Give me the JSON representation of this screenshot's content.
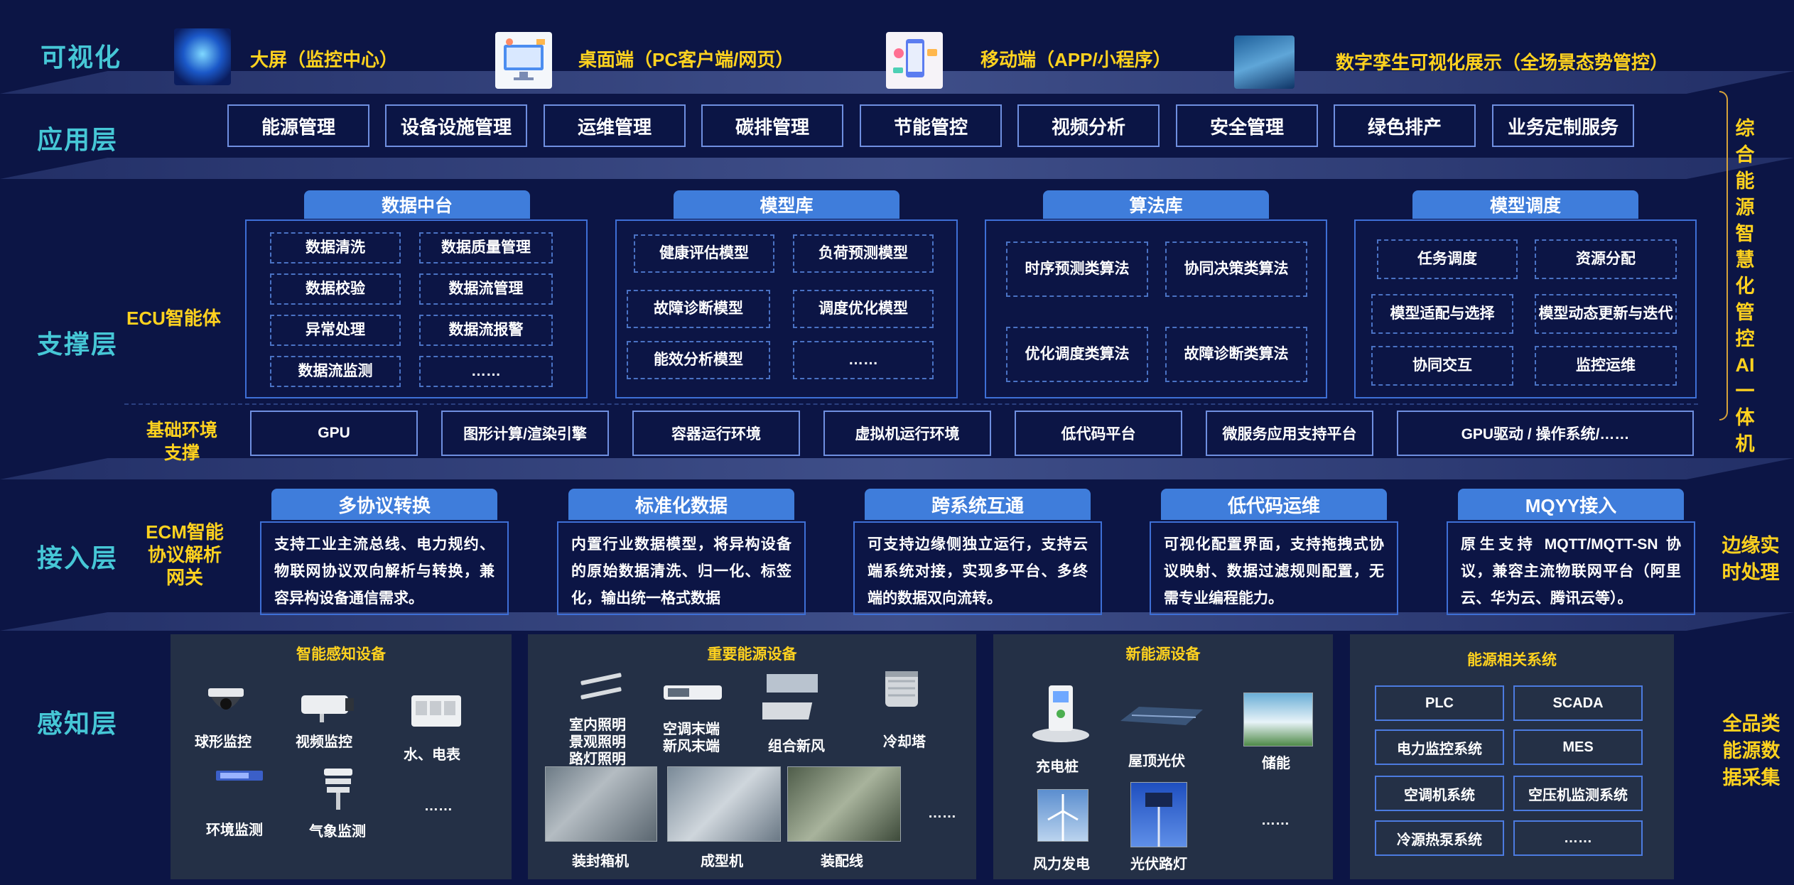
{
  "layers": {
    "visualization": "可视化",
    "application": "应用层",
    "support": "支撑层",
    "access": "接入层",
    "perception": "感知层"
  },
  "visualization_items": [
    "大屏（监控中心）",
    "桌面端（PC客户端/网页）",
    "移动端（APP/小程序）",
    "数字孪生可视化展示（全场景态势管控）"
  ],
  "application_items": [
    "能源管理",
    "设备设施管理",
    "运维管理",
    "碳排管理",
    "节能管控",
    "视频分析",
    "安全管理",
    "绿色排产",
    "业务定制服务"
  ],
  "side_labels": {
    "ecu": "ECU智能体",
    "base_env": "基础环境支撑",
    "ecm": "ECM智能协议解析网关",
    "right_top": "综合能源智慧化管控AI一体机",
    "right_mid": "边缘实时处理",
    "right_bottom": "全品类能源数据采集"
  },
  "support_modules": [
    {
      "title": "数据中台",
      "items": [
        "数据清洗",
        "数据质量管理",
        "数据校验",
        "数据流管理",
        "异常处理",
        "数据流报警",
        "数据流监测",
        "……"
      ]
    },
    {
      "title": "模型库",
      "items": [
        "健康评估模型",
        "负荷预测模型",
        "故障诊断模型",
        "调度优化模型",
        "能效分析模型",
        "……"
      ]
    },
    {
      "title": "算法库",
      "items": [
        "时序预测类算法",
        "协同决策类算法",
        "优化调度类算法",
        "故障诊断类算法"
      ]
    },
    {
      "title": "模型调度",
      "items": [
        "任务调度",
        "资源分配",
        "模型适配与选择",
        "模型动态更新与迭代",
        "协同交互",
        "监控运维"
      ]
    }
  ],
  "base_env_items": [
    "GPU",
    "图形计算/渲染引擎",
    "容器运行环境",
    "虚拟机运行环境",
    "低代码平台",
    "微服务应用支持平台",
    "GPU驱动 / 操作系统/……"
  ],
  "access_modules": [
    {
      "title": "多协议转换",
      "desc": "支持工业主流总线、电力规约、物联网协议双向解析与转换，兼容异构设备通信需求。"
    },
    {
      "title": "标准化数据",
      "desc": "内置行业数据模型，将异构设备的原始数据清洗、归一化、标签化，输出统一格式数据"
    },
    {
      "title": "跨系统互通",
      "desc": "可支持边缘侧独立运行，支持云端系统对接，实现多平台、多终端的数据双向流转。"
    },
    {
      "title": "低代码运维",
      "desc": "可视化配置界面，支持拖拽式协议映射、数据过滤规则配置，无需专业编程能力。"
    },
    {
      "title": "MQYY接入",
      "desc": "原生支持 MQTT/MQTT-SN 协议，兼容主流物联网平台（阿里云、华为云、腾讯云等）。"
    }
  ],
  "perception_panels": {
    "smart": {
      "title": "智能感知设备",
      "items": [
        "球形监控",
        "视频监控",
        "水、电表",
        "环境监测",
        "气象监测",
        "……"
      ]
    },
    "energy": {
      "title": "重要能源设备",
      "items": [
        "室内照明\n景观照明\n路灯照明",
        "空调末端\n新风末端",
        "组合新风",
        "冷却塔",
        "装封箱机",
        "成型机",
        "装配线",
        "……"
      ]
    },
    "new_energy": {
      "title": "新能源设备",
      "items": [
        "充电桩",
        "屋顶光伏",
        "储能",
        "风力发电",
        "光伏路灯",
        "……"
      ]
    },
    "systems": {
      "title": "能源相关系统",
      "items": [
        "PLC",
        "SCADA",
        "电力监控系统",
        "MES",
        "空调机系统",
        "空压机监测系统",
        "冷源热泵系统",
        "……"
      ]
    }
  },
  "colors": {
    "background": "#0c1545",
    "accent_yellow": "#ffd21f",
    "layer_teal": "#46c7d6",
    "title_blue": "#3f7ddb",
    "panel": "#243046"
  }
}
